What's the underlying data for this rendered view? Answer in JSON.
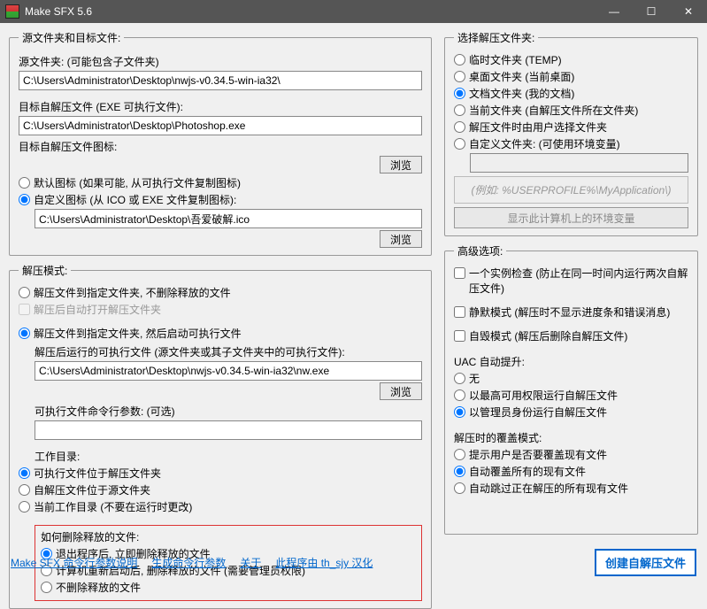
{
  "window": {
    "title": "Make SFX 5.6"
  },
  "left": {
    "group1_title": "源文件夹和目标文件:",
    "src_label": "源文件夹: (可能包含子文件夹)",
    "src_value": "C:\\Users\\Administrator\\Desktop\\nwjs-v0.34.5-win-ia32\\",
    "exe_label": "目标自解压文件 (EXE 可执行文件):",
    "exe_value": "C:\\Users\\Administrator\\Desktop\\Photoshop.exe",
    "icon_label": "目标自解压文件图标:",
    "browse": "浏览",
    "icon_default": "默认图标 (如果可能, 从可执行文件复制图标)",
    "icon_custom": "自定义图标 (从 ICO 或 EXE 文件复制图标):",
    "icon_value": "C:\\Users\\Administrator\\Desktop\\吾爱破解.ico",
    "group2_title": "解压模式:",
    "mode_nodelete": "解压文件到指定文件夹, 不删除释放的文件",
    "mode_autoopen": "解压后自动打开解压文件夹",
    "mode_run": "解压文件到指定文件夹, 然后启动可执行文件",
    "run_label": "解压后运行的可执行文件 (源文件夹或其子文件夹中的可执行文件):",
    "run_value": "C:\\Users\\Administrator\\Desktop\\nwjs-v0.34.5-win-ia32\\nw.exe",
    "args_label": "可执行文件命令行参数: (可选)",
    "args_value": "",
    "workdir_label": "工作目录:",
    "workdir_opt1": "可执行文件位于解压文件夹",
    "workdir_opt2": "自解压文件位于源文件夹",
    "workdir_opt3": "当前工作目录 (不要在运行时更改)",
    "delete_label": "如何删除释放的文件:",
    "delete_opt1": "退出程序后, 立即删除释放的文件",
    "delete_opt2": "计算机重新启动后, 删除释放的文件 (需要管理员权限)",
    "delete_opt3": "不删除释放的文件"
  },
  "right": {
    "group1_title": "选择解压文件夹:",
    "dest_temp": "临时文件夹 (TEMP)",
    "dest_desktop": "桌面文件夹 (当前桌面)",
    "dest_docs": "文档文件夹 (我的文档)",
    "dest_current": "当前文件夹 (自解压文件所在文件夹)",
    "dest_user": "解压文件时由用户选择文件夹",
    "dest_custom": "自定义文件夹: (可使用环境变量)",
    "env_hint": "(例如: %USERPROFILE%\\MyApplication\\)",
    "env_btn": "显示此计算机上的环境变量",
    "group2_title": "高级选项:",
    "adv_single": "一个实例检查 (防止在同一时间内运行两次自解压文件)",
    "adv_silent": "静默模式 (解压时不显示进度条和错误消息)",
    "adv_self": "自毁模式 (解压后删除自解压文件)",
    "uac_label": "UAC 自动提升:",
    "uac_none": "无",
    "uac_highest": "以最高可用权限运行自解压文件",
    "uac_admin": "以管理员身份运行自解压文件",
    "over_label": "解压时的覆盖模式:",
    "over_prompt": "提示用户是否要覆盖现有文件",
    "over_all": "自动覆盖所有的现有文件",
    "over_skip": "自动跳过正在解压的所有现有文件"
  },
  "footer": {
    "link1": "Make SFX 命令行参数说明",
    "link2": "生成命令行参数",
    "link3": "关于",
    "link4": "此程序由 th_sjy 汉化",
    "create": "创建自解压文件"
  }
}
